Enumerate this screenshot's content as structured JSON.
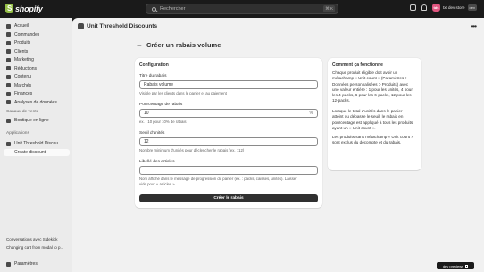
{
  "topbar": {
    "logo_text": "shopify",
    "search_placeholder": "Rechercher",
    "shortcut": "⌘ K",
    "store_initials": "tds",
    "store_name": "txt dev store",
    "store_tag": "dev"
  },
  "sidebar": {
    "items": [
      {
        "label": "Accueil",
        "icon": "home-icon"
      },
      {
        "label": "Commandes",
        "icon": "inbox-icon"
      },
      {
        "label": "Produits",
        "icon": "tag-icon"
      },
      {
        "label": "Clients",
        "icon": "person-icon"
      },
      {
        "label": "Marketing",
        "icon": "target-icon"
      },
      {
        "label": "Réductions",
        "icon": "discount-icon"
      },
      {
        "label": "Contenu",
        "icon": "content-icon"
      },
      {
        "label": "Marchés",
        "icon": "globe-icon"
      },
      {
        "label": "Finances",
        "icon": "bank-icon"
      },
      {
        "label": "Analyses de données",
        "icon": "chart-icon"
      }
    ],
    "sales_channels_label": "Canaux de vente",
    "online_store_label": "Boutique en ligne",
    "apps_label": "Applications",
    "app_item_label": "Unit Threshold Discou...",
    "app_sub_label": "Create discount",
    "bottom_links": [
      "Conversations avec Sidekick",
      "Changing cart from modal to p..."
    ],
    "settings_label": "Paramètres"
  },
  "app": {
    "title": "Unit Threshold Discounts",
    "more_label": "•••"
  },
  "page": {
    "back": "←",
    "title": "Créer un rabais volume"
  },
  "config": {
    "title": "Configuration",
    "title_label": "Titre du rabais",
    "title_value": "Rabais volume",
    "title_help": "Visible par les clients dans le panier et au paiement",
    "percent_label": "Pourcentage de rabais",
    "percent_value": "10",
    "percent_suffix": "%",
    "percent_help": "ex. : 10 pour 10% de rabais",
    "threshold_label": "Seuil d'unités",
    "threshold_value": "12",
    "threshold_help": "Nombre minimum d'unités pour déclencher le rabais (ex. : 12)",
    "item_label": "Libellé des articles",
    "item_value": "",
    "item_help_1": "Nom affiché dans le message de progression du panier (ex. : packs, caisses, unités). Laisser",
    "item_help_2": "vide pour « articles ».",
    "submit_label": "Créer le rabais"
  },
  "info": {
    "title": "Comment ça fonctionne",
    "p1": [
      "Chaque produit éligible doit avoir un",
      "métachamp « Unit count » (Paramètres >",
      "Données personnalisées > Produits) avec",
      "une valeur entière : 1 pour les unités, 4 pour",
      "les 4-packs, 6 pour les 6-packs, 12 pour les",
      "12-packs."
    ],
    "p2": [
      "Lorsque le total d'unités dans le panier",
      "atteint ou dépasse le seuil, le rabais en",
      "pourcentage est appliqué à tous les produits",
      "ayant un « Unit count »."
    ],
    "p3": [
      "Les produits sans métachamp « Unit count »",
      "sont exclus du décompte et du rabais."
    ]
  },
  "dev": {
    "label": "dev previews"
  }
}
